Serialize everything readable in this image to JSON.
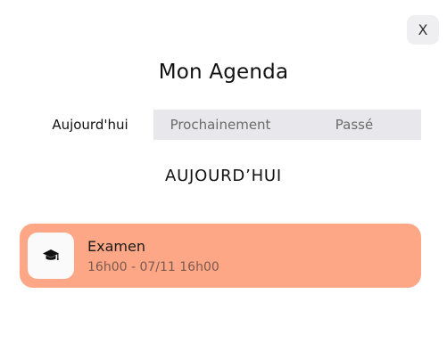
{
  "close_button": {
    "label": "X"
  },
  "agenda": {
    "title": "Mon Agenda",
    "tabs": [
      {
        "label": "Aujourd'hui",
        "active": true
      },
      {
        "label": "Prochainement",
        "active": false
      },
      {
        "label": "Passé",
        "active": false
      }
    ],
    "section_heading": "AUJOURD’HUI",
    "events": [
      {
        "icon": "graduation-cap-icon",
        "title": "Examen",
        "time": "16h00 - 07/11 16h00",
        "color": "#fea786"
      }
    ]
  }
}
